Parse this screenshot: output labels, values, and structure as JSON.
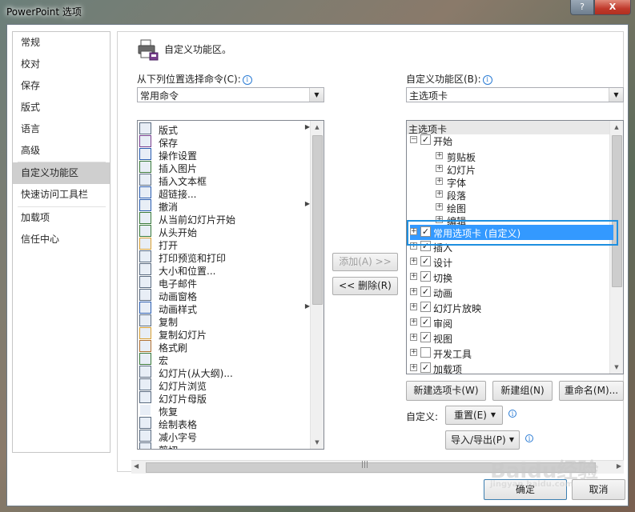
{
  "window": {
    "title": "PowerPoint 选项",
    "help_label": "?",
    "close_label": "X"
  },
  "nav": {
    "items": [
      {
        "label": "常规"
      },
      {
        "label": "校对"
      },
      {
        "label": "保存"
      },
      {
        "label": "版式"
      },
      {
        "label": "语言"
      },
      {
        "label": "高级"
      },
      {
        "label": "自定义功能区"
      },
      {
        "label": "快速访问工具栏"
      },
      {
        "label": "加载项"
      },
      {
        "label": "信任中心"
      }
    ],
    "selected": "自定义功能区"
  },
  "header": {
    "title": "自定义功能区。"
  },
  "left_list": {
    "label": "从下列位置选择命令(C):",
    "combo_value": "常用命令",
    "commands": [
      "版式",
      "保存",
      "操作设置",
      "插入图片",
      "插入文本框",
      "超链接...",
      "撤消",
      "从当前幻灯片开始",
      "从头开始",
      "打开",
      "打印预览和打印",
      "大小和位置...",
      "电子邮件",
      "动画窗格",
      "动画样式",
      "复制",
      "复制幻灯片",
      "格式刷",
      "宏",
      "幻灯片(从大纲)...",
      "幻灯片浏览",
      "幻灯片母版",
      "恢复",
      "绘制表格",
      "减小字号",
      "剪切"
    ]
  },
  "right_list": {
    "label": "自定义功能区(B):",
    "combo_value": "主选项卡",
    "header": "主选项卡",
    "start_tab": "开始",
    "groups": [
      "剪贴板",
      "幻灯片",
      "字体",
      "段落",
      "绘图",
      "编辑"
    ],
    "selected_tab": "常用选项卡 (自定义)",
    "tabs": [
      "插入",
      "设计",
      "切换",
      "动画",
      "幻灯片放映",
      "审阅",
      "视图",
      "开发工具",
      "加载项"
    ]
  },
  "buttons": {
    "add": "添加(A) >>",
    "remove": "<< 删除(R)",
    "new_tab": "新建选项卡(W)",
    "new_group": "新建组(N)",
    "rename": "重命名(M)...",
    "customize_label": "自定义:",
    "reset": "重置(E)",
    "import_export": "导入/导出(P)",
    "ok": "确定",
    "cancel": "取消"
  },
  "watermark": {
    "brand": "Baidu经验",
    "url": "jingyan.baidu.com"
  }
}
